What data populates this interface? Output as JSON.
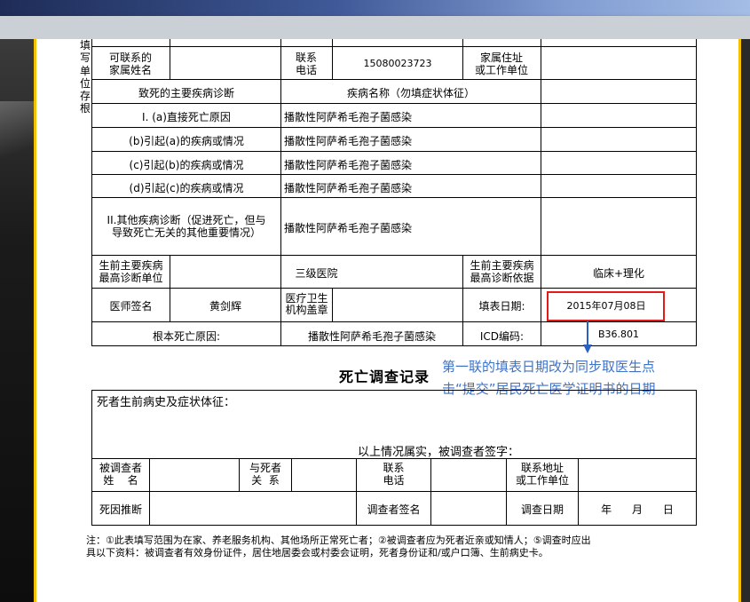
{
  "side_label": "填写单位存根",
  "contact": {
    "label": "可联系的\n家属姓名",
    "phone_label": "联系\n电话",
    "phone": "15080023723",
    "address_label": "家属住址\n或工作单位"
  },
  "diagnosis": {
    "header_left": "致死的主要疾病诊断",
    "header_mid": "疾病名称（勿填症状体征）",
    "rows": [
      {
        "label": "I. (a)直接死亡原因",
        "value": "播散性阿萨希毛孢子菌感染"
      },
      {
        "label": "(b)引起(a)的疾病或情况",
        "value": "播散性阿萨希毛孢子菌感染"
      },
      {
        "label": "(c)引起(b)的疾病或情况",
        "value": "播散性阿萨希毛孢子菌感染"
      },
      {
        "label": "(d)引起(c)的疾病或情况",
        "value": "播散性阿萨希毛孢子菌感染"
      }
    ],
    "other_label": "II.其他疾病诊断（促进死亡，但与\n导致死亡无关的其他重要情况）",
    "other_value": "播散性阿萨希毛孢子菌感染"
  },
  "unit": {
    "label": "生前主要疾病\n最高诊断单位",
    "value": "三级医院",
    "basis_label": "生前主要疾病\n最高诊断依据",
    "basis_value": "临床+理化"
  },
  "sign": {
    "doctor_label": "医师签名",
    "doctor": "黄剑辉",
    "seal_label": "医疗卫生\n机构盖章",
    "date_label": "填表日期:",
    "date": "2015年07月08日"
  },
  "root": {
    "label": "根本死亡原因:",
    "value": "播散性阿萨希毛孢子菌感染",
    "icd_label": "ICD编码:",
    "icd": "B36.801"
  },
  "survey": {
    "title": "死亡调查记录",
    "history_label": "死者生前病史及症状体征：",
    "confirm": "以上情况属实，被调查者签字：",
    "respondent_label": "被调查者\n姓    名",
    "relation_label": "与死者\n关  系",
    "phone_label": "联系\n电话",
    "address_label": "联系地址\n或工作单位",
    "inference_label": "死因推断",
    "investigator_label": "调查者签名",
    "date_label": "调查日期",
    "date_value": "年      月      日"
  },
  "annotation": {
    "line1": "第一联的填表日期改为同步取医生点",
    "line2": "击“提交”居民死亡医学证明书的日期",
    "color": "#3e73c8"
  },
  "footer": {
    "line1": "注：①此表填写范围为在家、养老服务机构、其他场所正常死亡者；②被调查者应为死者近亲或知情人；⑤调查时应出",
    "line2": "具以下资料：被调查者有效身份证件，居住地居委会或村委会证明，死者身份证和/或户口簿、生前病史卡。"
  }
}
